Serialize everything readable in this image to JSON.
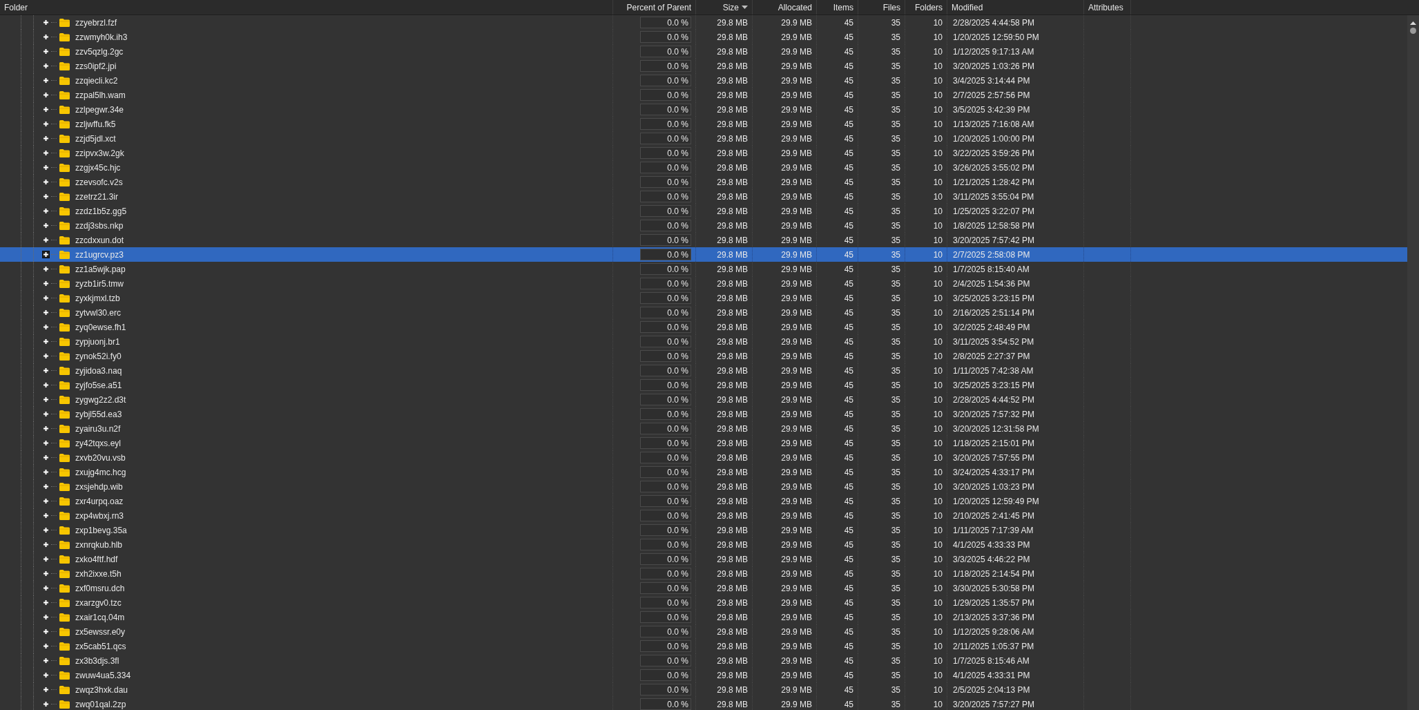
{
  "columns": [
    {
      "label": "Folder",
      "sorted": false
    },
    {
      "label": "Percent of Parent",
      "sorted": false
    },
    {
      "label": "Size",
      "sorted": true
    },
    {
      "label": "Allocated",
      "sorted": false
    },
    {
      "label": "Items",
      "sorted": false
    },
    {
      "label": "Files",
      "sorted": false
    },
    {
      "label": "Folders",
      "sorted": false
    },
    {
      "label": "Modified",
      "sorted": false
    },
    {
      "label": "Attributes",
      "sorted": false
    }
  ],
  "rows": [
    {
      "name": "zzyebrzl.fzf",
      "percent": "0.0 %",
      "level": 0,
      "size": "29.8 MB",
      "allocated": "29.9 MB",
      "items": "45",
      "files": "35",
      "folders": "10",
      "modified": "2/28/2025 4:44:58 PM",
      "expanded": false,
      "selected": false
    },
    {
      "name": "zzwmyh0k.ih3",
      "percent": "0.0 %",
      "level": 0,
      "size": "29.8 MB",
      "allocated": "29.9 MB",
      "items": "45",
      "files": "35",
      "folders": "10",
      "modified": "1/20/2025 12:59:50 PM",
      "expanded": false,
      "selected": false
    },
    {
      "name": "zzv5qzlg.2gc",
      "percent": "0.0 %",
      "level": 0,
      "size": "29.8 MB",
      "allocated": "29.9 MB",
      "items": "45",
      "files": "35",
      "folders": "10",
      "modified": "1/12/2025 9:17:13 AM",
      "expanded": false,
      "selected": false
    },
    {
      "name": "zzs0ipf2.jpi",
      "percent": "0.0 %",
      "level": 0,
      "size": "29.8 MB",
      "allocated": "29.9 MB",
      "items": "45",
      "files": "35",
      "folders": "10",
      "modified": "3/20/2025 1:03:26 PM",
      "expanded": false,
      "selected": false
    },
    {
      "name": "zzqiecli.kc2",
      "percent": "0.0 %",
      "level": 0,
      "size": "29.8 MB",
      "allocated": "29.9 MB",
      "items": "45",
      "files": "35",
      "folders": "10",
      "modified": "3/4/2025 3:14:44 PM",
      "expanded": false,
      "selected": false
    },
    {
      "name": "zzpal5lh.wam",
      "percent": "0.0 %",
      "level": 0,
      "size": "29.8 MB",
      "allocated": "29.9 MB",
      "items": "45",
      "files": "35",
      "folders": "10",
      "modified": "2/7/2025 2:57:56 PM",
      "expanded": false,
      "selected": false
    },
    {
      "name": "zzlpegwr.34e",
      "percent": "0.0 %",
      "level": 0,
      "size": "29.8 MB",
      "allocated": "29.9 MB",
      "items": "45",
      "files": "35",
      "folders": "10",
      "modified": "3/5/2025 3:42:39 PM",
      "expanded": false,
      "selected": false
    },
    {
      "name": "zzljwffu.fk5",
      "percent": "0.0 %",
      "level": 0,
      "size": "29.8 MB",
      "allocated": "29.9 MB",
      "items": "45",
      "files": "35",
      "folders": "10",
      "modified": "1/13/2025 7:16:08 AM",
      "expanded": false,
      "selected": false
    },
    {
      "name": "zzjd5jdl.xct",
      "percent": "0.0 %",
      "level": 0,
      "size": "29.8 MB",
      "allocated": "29.9 MB",
      "items": "45",
      "files": "35",
      "folders": "10",
      "modified": "1/20/2025 1:00:00 PM",
      "expanded": false,
      "selected": false
    },
    {
      "name": "zzipvx3w.2gk",
      "percent": "0.0 %",
      "level": 0,
      "size": "29.8 MB",
      "allocated": "29.9 MB",
      "items": "45",
      "files": "35",
      "folders": "10",
      "modified": "3/22/2025 3:59:26 PM",
      "expanded": false,
      "selected": false
    },
    {
      "name": "zzgjx45c.hjc",
      "percent": "0.0 %",
      "level": 0,
      "size": "29.8 MB",
      "allocated": "29.9 MB",
      "items": "45",
      "files": "35",
      "folders": "10",
      "modified": "3/26/2025 3:55:02 PM",
      "expanded": false,
      "selected": false
    },
    {
      "name": "zzevsofc.v2s",
      "percent": "0.0 %",
      "level": 0,
      "size": "29.8 MB",
      "allocated": "29.9 MB",
      "items": "45",
      "files": "35",
      "folders": "10",
      "modified": "1/21/2025 1:28:42 PM",
      "expanded": false,
      "selected": false
    },
    {
      "name": "zzetrz21.3ir",
      "percent": "0.0 %",
      "level": 0,
      "size": "29.8 MB",
      "allocated": "29.9 MB",
      "items": "45",
      "files": "35",
      "folders": "10",
      "modified": "3/11/2025 3:55:04 PM",
      "expanded": false,
      "selected": false
    },
    {
      "name": "zzdz1b5z.gg5",
      "percent": "0.0 %",
      "level": 0,
      "size": "29.8 MB",
      "allocated": "29.9 MB",
      "items": "45",
      "files": "35",
      "folders": "10",
      "modified": "1/25/2025 3:22:07 PM",
      "expanded": false,
      "selected": false
    },
    {
      "name": "zzdj3sbs.nkp",
      "percent": "0.0 %",
      "level": 0,
      "size": "29.8 MB",
      "allocated": "29.9 MB",
      "items": "45",
      "files": "35",
      "folders": "10",
      "modified": "1/8/2025 12:58:58 PM",
      "expanded": false,
      "selected": false
    },
    {
      "name": "zzcdxxun.dot",
      "percent": "0.0 %",
      "level": 0,
      "size": "29.8 MB",
      "allocated": "29.9 MB",
      "items": "45",
      "files": "35",
      "folders": "10",
      "modified": "3/20/2025 7:57:42 PM",
      "expanded": false,
      "selected": false
    },
    {
      "name": "zz1ugrcv.pz3",
      "percent": "0.0 %",
      "level": 0,
      "size": "29.8 MB",
      "allocated": "29.9 MB",
      "items": "45",
      "files": "35",
      "folders": "10",
      "modified": "2/7/2025 2:58:08 PM",
      "expanded": false,
      "selected": true
    },
    {
      "name": "zz1a5wjk.pap",
      "percent": "0.0 %",
      "level": 0,
      "size": "29.8 MB",
      "allocated": "29.9 MB",
      "items": "45",
      "files": "35",
      "folders": "10",
      "modified": "1/7/2025 8:15:40 AM",
      "expanded": false,
      "selected": false
    },
    {
      "name": "zyzb1ir5.tmw",
      "percent": "0.0 %",
      "level": 0,
      "size": "29.8 MB",
      "allocated": "29.9 MB",
      "items": "45",
      "files": "35",
      "folders": "10",
      "modified": "2/4/2025 1:54:36 PM",
      "expanded": false,
      "selected": false
    },
    {
      "name": "zyxkjmxl.tzb",
      "percent": "0.0 %",
      "level": 0,
      "size": "29.8 MB",
      "allocated": "29.9 MB",
      "items": "45",
      "files": "35",
      "folders": "10",
      "modified": "3/25/2025 3:23:15 PM",
      "expanded": false,
      "selected": false
    },
    {
      "name": "zytvwl30.erc",
      "percent": "0.0 %",
      "level": 0,
      "size": "29.8 MB",
      "allocated": "29.9 MB",
      "items": "45",
      "files": "35",
      "folders": "10",
      "modified": "2/16/2025 2:51:14 PM",
      "expanded": false,
      "selected": false
    },
    {
      "name": "zyq0ewse.fh1",
      "percent": "0.0 %",
      "level": 0,
      "size": "29.8 MB",
      "allocated": "29.9 MB",
      "items": "45",
      "files": "35",
      "folders": "10",
      "modified": "3/2/2025 2:48:49 PM",
      "expanded": false,
      "selected": false
    },
    {
      "name": "zypjuonj.br1",
      "percent": "0.0 %",
      "level": 0,
      "size": "29.8 MB",
      "allocated": "29.9 MB",
      "items": "45",
      "files": "35",
      "folders": "10",
      "modified": "3/11/2025 3:54:52 PM",
      "expanded": false,
      "selected": false
    },
    {
      "name": "zynok52i.fy0",
      "percent": "0.0 %",
      "level": 0,
      "size": "29.8 MB",
      "allocated": "29.9 MB",
      "items": "45",
      "files": "35",
      "folders": "10",
      "modified": "2/8/2025 2:27:37 PM",
      "expanded": false,
      "selected": false
    },
    {
      "name": "zyjidoa3.naq",
      "percent": "0.0 %",
      "level": 0,
      "size": "29.8 MB",
      "allocated": "29.9 MB",
      "items": "45",
      "files": "35",
      "folders": "10",
      "modified": "1/11/2025 7:42:38 AM",
      "expanded": false,
      "selected": false
    },
    {
      "name": "zyjfo5se.a51",
      "percent": "0.0 %",
      "level": 0,
      "size": "29.8 MB",
      "allocated": "29.9 MB",
      "items": "45",
      "files": "35",
      "folders": "10",
      "modified": "3/25/2025 3:23:15 PM",
      "expanded": false,
      "selected": false
    },
    {
      "name": "zygwg2z2.d3t",
      "percent": "0.0 %",
      "level": 0,
      "size": "29.8 MB",
      "allocated": "29.9 MB",
      "items": "45",
      "files": "35",
      "folders": "10",
      "modified": "2/28/2025 4:44:52 PM",
      "expanded": false,
      "selected": false
    },
    {
      "name": "zybjl55d.ea3",
      "percent": "0.0 %",
      "level": 0,
      "size": "29.8 MB",
      "allocated": "29.9 MB",
      "items": "45",
      "files": "35",
      "folders": "10",
      "modified": "3/20/2025 7:57:32 PM",
      "expanded": false,
      "selected": false
    },
    {
      "name": "zyairu3u.n2f",
      "percent": "0.0 %",
      "level": 0,
      "size": "29.8 MB",
      "allocated": "29.9 MB",
      "items": "45",
      "files": "35",
      "folders": "10",
      "modified": "3/20/2025 12:31:58 PM",
      "expanded": false,
      "selected": false
    },
    {
      "name": "zy42tqxs.eyl",
      "percent": "0.0 %",
      "level": 0,
      "size": "29.8 MB",
      "allocated": "29.9 MB",
      "items": "45",
      "files": "35",
      "folders": "10",
      "modified": "1/18/2025 2:15:01 PM",
      "expanded": false,
      "selected": false
    },
    {
      "name": "zxvb20vu.vsb",
      "percent": "0.0 %",
      "level": 0,
      "size": "29.8 MB",
      "allocated": "29.9 MB",
      "items": "45",
      "files": "35",
      "folders": "10",
      "modified": "3/20/2025 7:57:55 PM",
      "expanded": false,
      "selected": false
    },
    {
      "name": "zxujg4mc.hcg",
      "percent": "0.0 %",
      "level": 0,
      "size": "29.8 MB",
      "allocated": "29.9 MB",
      "items": "45",
      "files": "35",
      "folders": "10",
      "modified": "3/24/2025 4:33:17 PM",
      "expanded": false,
      "selected": false
    },
    {
      "name": "zxsjehdp.wib",
      "percent": "0.0 %",
      "level": 0,
      "size": "29.8 MB",
      "allocated": "29.9 MB",
      "items": "45",
      "files": "35",
      "folders": "10",
      "modified": "3/20/2025 1:03:23 PM",
      "expanded": false,
      "selected": false
    },
    {
      "name": "zxr4urpq.oaz",
      "percent": "0.0 %",
      "level": 0,
      "size": "29.8 MB",
      "allocated": "29.9 MB",
      "items": "45",
      "files": "35",
      "folders": "10",
      "modified": "1/20/2025 12:59:49 PM",
      "expanded": false,
      "selected": false
    },
    {
      "name": "zxp4wbxj.rn3",
      "percent": "0.0 %",
      "level": 0,
      "size": "29.8 MB",
      "allocated": "29.9 MB",
      "items": "45",
      "files": "35",
      "folders": "10",
      "modified": "2/10/2025 2:41:45 PM",
      "expanded": false,
      "selected": false
    },
    {
      "name": "zxp1bevg.35a",
      "percent": "0.0 %",
      "level": 0,
      "size": "29.8 MB",
      "allocated": "29.9 MB",
      "items": "45",
      "files": "35",
      "folders": "10",
      "modified": "1/11/2025 7:17:39 AM",
      "expanded": false,
      "selected": false
    },
    {
      "name": "zxnrqkub.hlb",
      "percent": "0.0 %",
      "level": 0,
      "size": "29.8 MB",
      "allocated": "29.9 MB",
      "items": "45",
      "files": "35",
      "folders": "10",
      "modified": "4/1/2025 4:33:33 PM",
      "expanded": false,
      "selected": false
    },
    {
      "name": "zxko4ftf.hdf",
      "percent": "0.0 %",
      "level": 0,
      "size": "29.8 MB",
      "allocated": "29.9 MB",
      "items": "45",
      "files": "35",
      "folders": "10",
      "modified": "3/3/2025 4:46:22 PM",
      "expanded": false,
      "selected": false
    },
    {
      "name": "zxh2ixxe.t5h",
      "percent": "0.0 %",
      "level": 0,
      "size": "29.8 MB",
      "allocated": "29.9 MB",
      "items": "45",
      "files": "35",
      "folders": "10",
      "modified": "1/18/2025 2:14:54 PM",
      "expanded": false,
      "selected": false
    },
    {
      "name": "zxf0msru.dch",
      "percent": "0.0 %",
      "level": 0,
      "size": "29.8 MB",
      "allocated": "29.9 MB",
      "items": "45",
      "files": "35",
      "folders": "10",
      "modified": "3/30/2025 5:30:58 PM",
      "expanded": false,
      "selected": false
    },
    {
      "name": "zxarzgv0.tzc",
      "percent": "0.0 %",
      "level": 0,
      "size": "29.8 MB",
      "allocated": "29.9 MB",
      "items": "45",
      "files": "35",
      "folders": "10",
      "modified": "1/29/2025 1:35:57 PM",
      "expanded": false,
      "selected": false
    },
    {
      "name": "zxair1cq.04m",
      "percent": "0.0 %",
      "level": 0,
      "size": "29.8 MB",
      "allocated": "29.9 MB",
      "items": "45",
      "files": "35",
      "folders": "10",
      "modified": "2/13/2025 3:37:36 PM",
      "expanded": false,
      "selected": false
    },
    {
      "name": "zx5ewssr.e0y",
      "percent": "0.0 %",
      "level": 0,
      "size": "29.8 MB",
      "allocated": "29.9 MB",
      "items": "45",
      "files": "35",
      "folders": "10",
      "modified": "1/12/2025 9:28:06 AM",
      "expanded": false,
      "selected": false
    },
    {
      "name": "zx5cab51.qcs",
      "percent": "0.0 %",
      "level": 0,
      "size": "29.8 MB",
      "allocated": "29.9 MB",
      "items": "45",
      "files": "35",
      "folders": "10",
      "modified": "2/11/2025 1:05:37 PM",
      "expanded": false,
      "selected": false
    },
    {
      "name": "zx3b3djs.3fl",
      "percent": "0.0 %",
      "level": 0,
      "size": "29.8 MB",
      "allocated": "29.9 MB",
      "items": "45",
      "files": "35",
      "folders": "10",
      "modified": "1/7/2025 8:15:46 AM",
      "expanded": false,
      "selected": false
    },
    {
      "name": "zwuw4ua5.334",
      "percent": "0.0 %",
      "level": 0,
      "size": "29.8 MB",
      "allocated": "29.9 MB",
      "items": "45",
      "files": "35",
      "folders": "10",
      "modified": "4/1/2025 4:33:31 PM",
      "expanded": false,
      "selected": false
    },
    {
      "name": "zwqz3hxk.dau",
      "percent": "0.0 %",
      "level": 0,
      "size": "29.8 MB",
      "allocated": "29.9 MB",
      "items": "45",
      "files": "35",
      "folders": "10",
      "modified": "2/5/2025 2:04:13 PM",
      "expanded": false,
      "selected": false
    },
    {
      "name": "zwq01qal.2zp",
      "percent": "0.0 %",
      "level": 0,
      "size": "29.8 MB",
      "allocated": "29.9 MB",
      "items": "45",
      "files": "35",
      "folders": "10",
      "modified": "3/20/2025 7:57:27 PM",
      "expanded": false,
      "selected": false
    }
  ]
}
